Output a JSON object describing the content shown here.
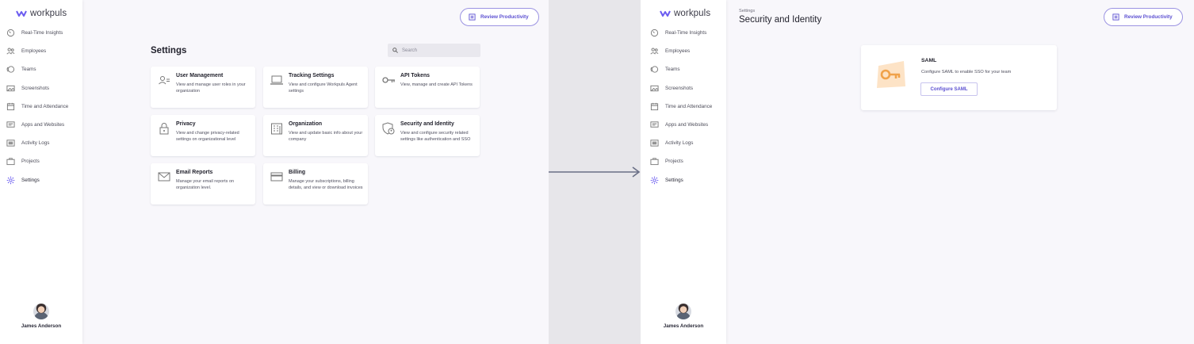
{
  "app": {
    "logo_text": "workpuls"
  },
  "sidebar": {
    "items": [
      {
        "label": "Real-Time Insights",
        "icon": "gauge-icon"
      },
      {
        "label": "Employees",
        "icon": "people-icon"
      },
      {
        "label": "Teams",
        "icon": "teams-icon"
      },
      {
        "label": "Screenshots",
        "icon": "image-icon"
      },
      {
        "label": "Time and Attendance",
        "icon": "calendar-icon"
      },
      {
        "label": "Apps and Websites",
        "icon": "monitor-icon"
      },
      {
        "label": "Activity Logs",
        "icon": "list-icon"
      },
      {
        "label": "Projects",
        "icon": "briefcase-icon"
      },
      {
        "label": "Settings",
        "icon": "gear-icon"
      }
    ],
    "user": {
      "name": "James Anderson"
    }
  },
  "header": {
    "review_label": "Review Productivity"
  },
  "settings_page": {
    "title": "Settings",
    "search_placeholder": "Search",
    "cards": [
      {
        "title": "User Management",
        "desc": "View and manage user roles in your organization",
        "icon": "user-roles-icon"
      },
      {
        "title": "Tracking Settings",
        "desc": "View and configure Workpuls Agent settings",
        "icon": "laptop-icon"
      },
      {
        "title": "API Tokens",
        "desc": "View, manage and create API Tokens",
        "icon": "key-icon"
      },
      {
        "title": "Privacy",
        "desc": "View and change privacy-related settings on organizational level",
        "icon": "lock-icon"
      },
      {
        "title": "Organization",
        "desc": "View and update basic info about your company",
        "icon": "building-icon"
      },
      {
        "title": "Security and Identity",
        "desc": "View and configure security related settings like authentication and SSO",
        "icon": "shield-user-icon"
      },
      {
        "title": "Email Reports",
        "desc": "Manage your email reports on organization level.",
        "icon": "envelope-icon"
      },
      {
        "title": "Billing",
        "desc": "Manage your subscriptions, billing details, and view or download invoices",
        "icon": "credit-card-icon"
      }
    ]
  },
  "security_page": {
    "breadcrumb": "Settings",
    "title": "Security and Identity",
    "saml": {
      "title": "SAML",
      "desc": "Configure SAML to enable SSO for your team",
      "button": "Configure SAML"
    }
  },
  "colors": {
    "accent": "#5b4fd1",
    "accent_border": "#9b93e2",
    "saml_orange": "#f0a24a"
  }
}
